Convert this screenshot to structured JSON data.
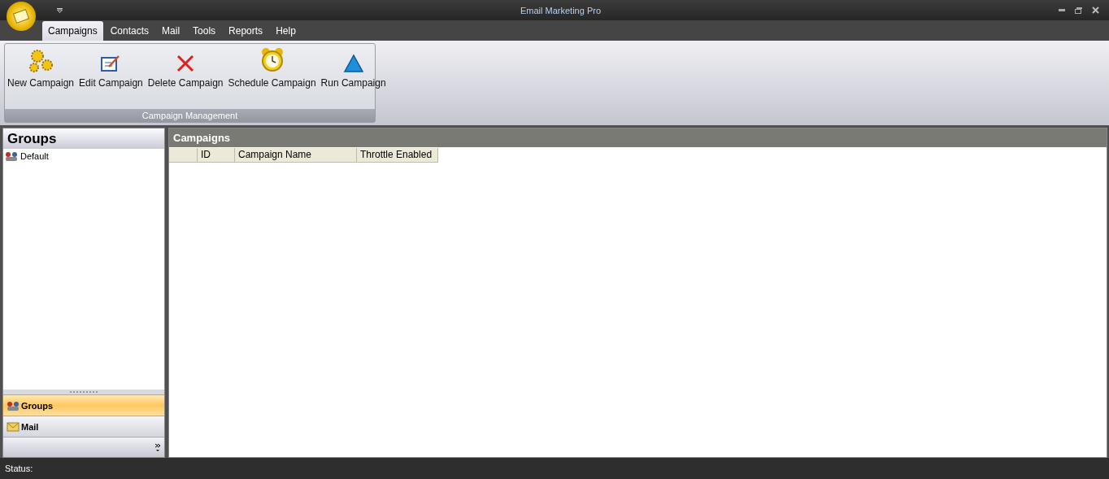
{
  "window": {
    "title": "Email Marketing Pro"
  },
  "tabs": [
    {
      "label": "Campaigns",
      "selected": true
    },
    {
      "label": "Contacts",
      "selected": false
    },
    {
      "label": "Mail",
      "selected": false
    },
    {
      "label": "Tools",
      "selected": false
    },
    {
      "label": "Reports",
      "selected": false
    },
    {
      "label": "Help",
      "selected": false
    }
  ],
  "ribbon_group": {
    "title": "Campaign Management",
    "buttons": [
      {
        "label": "New Campaign",
        "kind": "new"
      },
      {
        "label": "Edit Campaign",
        "kind": "edit"
      },
      {
        "label": "Delete Campaign",
        "kind": "delete"
      },
      {
        "label": "Schedule Campaign",
        "kind": "schedule"
      },
      {
        "label": "Run Campaign",
        "kind": "run"
      }
    ]
  },
  "sidebar": {
    "title": "Groups",
    "items": [
      {
        "label": "Default"
      }
    ],
    "nav": [
      {
        "label": "Groups",
        "kind": "groups",
        "selected": true
      },
      {
        "label": "Mail",
        "kind": "mail",
        "selected": false
      }
    ]
  },
  "main": {
    "title": "Campaigns",
    "columns": [
      "ID",
      "Campaign Name",
      "Throttle Enabled"
    ]
  },
  "status_bar": {
    "label": "Status:"
  }
}
